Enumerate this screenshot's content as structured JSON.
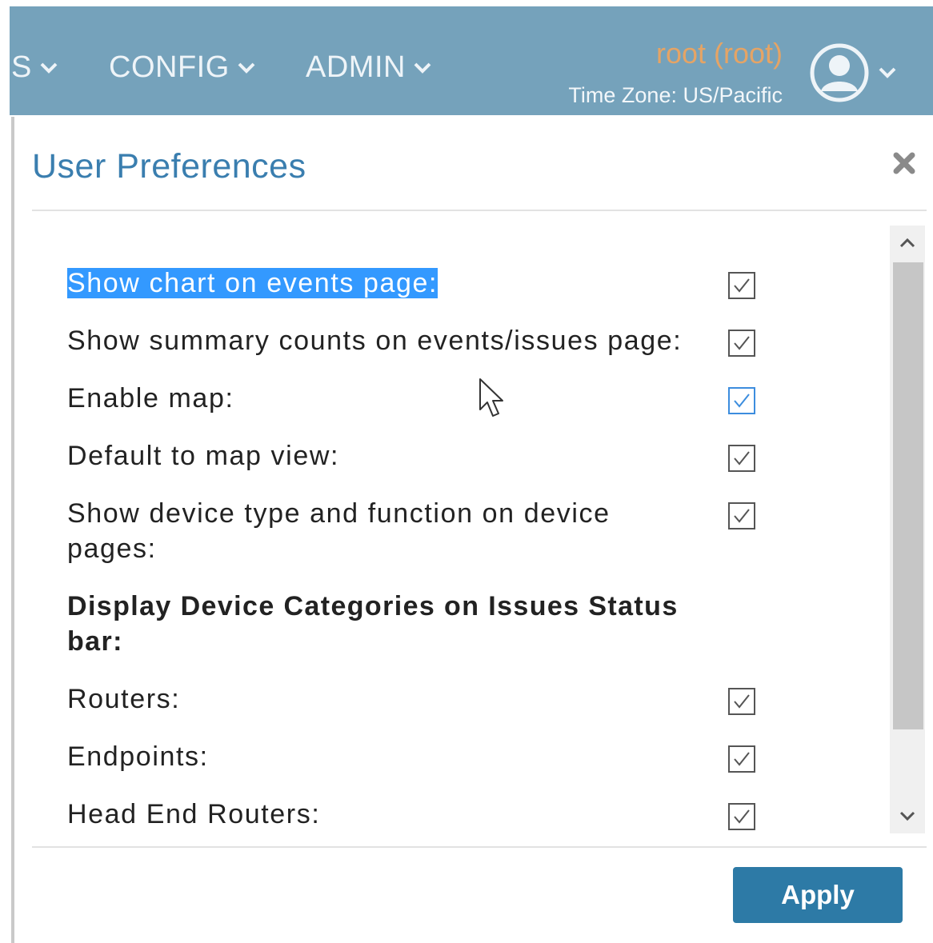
{
  "nav": {
    "items": [
      {
        "label": "S"
      },
      {
        "label": "CONFIG"
      },
      {
        "label": "ADMIN"
      }
    ],
    "user": {
      "name": "root (root)",
      "timezone": "Time Zone: US/Pacific"
    }
  },
  "dialog": {
    "title": "User Preferences",
    "rows": [
      {
        "label": "Show chart on events page:",
        "checked": true
      },
      {
        "label": "Show summary counts on events/issues page:",
        "checked": true
      },
      {
        "label": "Enable map:",
        "checked": true
      },
      {
        "label": "Default to map view:",
        "checked": true
      },
      {
        "label": "Show device type and function on device pages:",
        "checked": true
      }
    ],
    "section_heading": "Display Device Categories on Issues Status bar:",
    "category_rows": [
      {
        "label": "Routers:",
        "checked": true
      },
      {
        "label": "Endpoints:",
        "checked": true
      },
      {
        "label": "Head End Routers:",
        "checked": true
      }
    ],
    "apply_label": "Apply"
  },
  "colors": {
    "nav_background": "#75a2bb",
    "user_name": "#e5a465",
    "title": "#3a7eaf",
    "apply_button": "#2d7aa6",
    "selection_highlight": "#3399ff",
    "focused_checkbox": "#3c8dde"
  },
  "icons": {
    "nav_chevron": "chevron-down-icon",
    "avatar": "user-avatar-icon",
    "close": "close-icon",
    "checkbox": "checkmark-icon",
    "scroll_up": "scroll-up-arrow-icon",
    "scroll_down": "scroll-down-arrow-icon",
    "pointer": "mouse-pointer-icon"
  }
}
